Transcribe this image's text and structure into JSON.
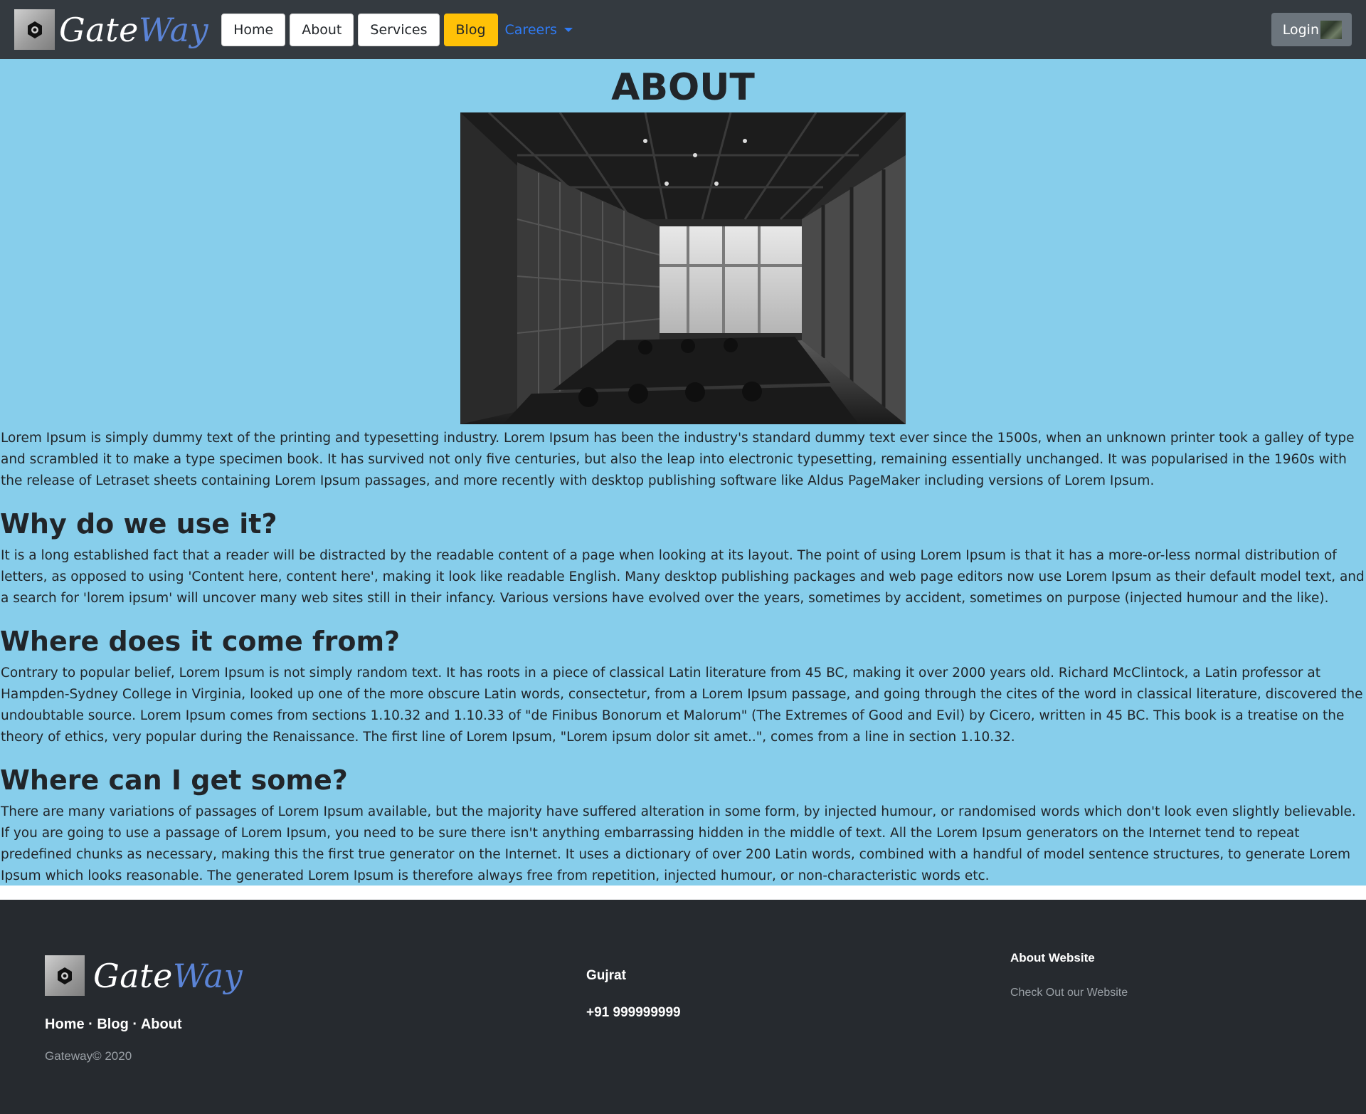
{
  "colors": {
    "navbar_bg": "#343a40",
    "main_bg": "#87ceeb",
    "footer_bg": "#262a2f",
    "blog_button": "#ffc107",
    "careers_link": "#2f7bf5",
    "login_button": "#6c757d",
    "brand_way": "#5b84d6"
  },
  "navbar": {
    "brand": {
      "part1": "Gate",
      "part2": "Way",
      "logo_icon": "gateway-logo-icon"
    },
    "items": [
      {
        "label": "Home"
      },
      {
        "label": "About"
      },
      {
        "label": "Services"
      },
      {
        "label": "Blog"
      }
    ],
    "dropdown_label": "Careers",
    "login_label": "Login"
  },
  "main": {
    "title": "ABOUT",
    "intro": "Lorem Ipsum is simply dummy text of the printing and typesetting industry. Lorem Ipsum has been the industry's standard dummy text ever since the 1500s, when an unknown printer took a galley of type and scrambled it to make a type specimen book. It has survived not only five centuries, but also the leap into electronic typesetting, remaining essentially unchanged. It was popularised in the 1960s with the release of Letraset sheets containing Lorem Ipsum passages, and more recently with desktop publishing software like Aldus PageMaker including versions of Lorem Ipsum.",
    "sections": [
      {
        "heading": "Why do we use it?",
        "body": "It is a long established fact that a reader will be distracted by the readable content of a page when looking at its layout. The point of using Lorem Ipsum is that it has a more-or-less normal distribution of letters, as opposed to using 'Content here, content here', making it look like readable English. Many desktop publishing packages and web page editors now use Lorem Ipsum as their default model text, and a search for 'lorem ipsum' will uncover many web sites still in their infancy. Various versions have evolved over the years, sometimes by accident, sometimes on purpose (injected humour and the like)."
      },
      {
        "heading": "Where does it come from?",
        "body": "Contrary to popular belief, Lorem Ipsum is not simply random text. It has roots in a piece of classical Latin literature from 45 BC, making it over 2000 years old. Richard McClintock, a Latin professor at Hampden-Sydney College in Virginia, looked up one of the more obscure Latin words, consectetur, from a Lorem Ipsum passage, and going through the cites of the word in classical literature, discovered the undoubtable source. Lorem Ipsum comes from sections 1.10.32 and 1.10.33 of \"de Finibus Bonorum et Malorum\" (The Extremes of Good and Evil) by Cicero, written in 45 BC. This book is a treatise on the theory of ethics, very popular during the Renaissance. The first line of Lorem Ipsum, \"Lorem ipsum dolor sit amet..\", comes from a line in section 1.10.32."
      },
      {
        "heading": "Where can I get some?",
        "body": "There are many variations of passages of Lorem Ipsum available, but the majority have suffered alteration in some form, by injected humour, or randomised words which don't look even slightly believable. If you are going to use a passage of Lorem Ipsum, you need to be sure there isn't anything embarrassing hidden in the middle of text. All the Lorem Ipsum generators on the Internet tend to repeat predefined chunks as necessary, making this the first true generator on the Internet. It uses a dictionary of over 200 Latin words, combined with a handful of model sentence structures, to generate Lorem Ipsum which looks reasonable. The generated Lorem Ipsum is therefore always free from repetition, injected humour, or non-characteristic words etc."
      }
    ]
  },
  "footer": {
    "brand": {
      "part1": "Gate",
      "part2": "Way"
    },
    "links": [
      "Home",
      "Blog",
      "About"
    ],
    "separator": " · ",
    "copyright": "Gateway© 2020",
    "city": "Gujrat",
    "phone": "+91 999999999",
    "about_heading": "About Website",
    "about_link": "Check Out our Website"
  }
}
